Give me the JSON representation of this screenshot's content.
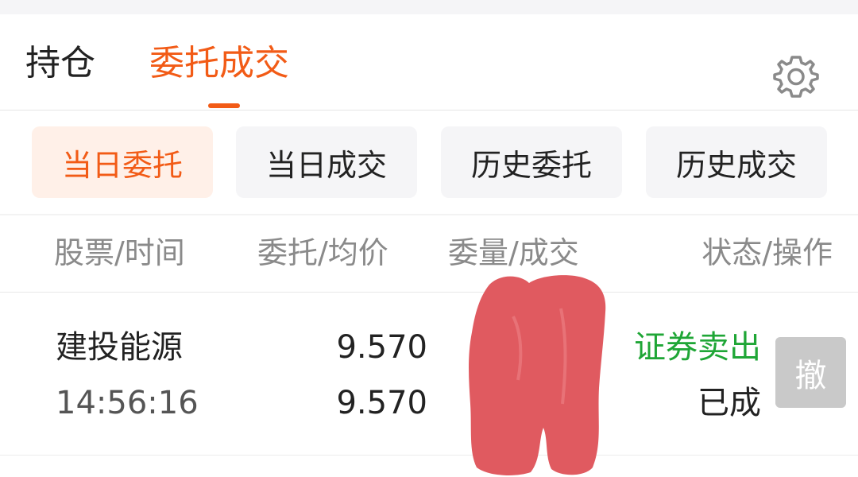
{
  "tabs": {
    "holdings": "持仓",
    "orders": "委托成交"
  },
  "filters": {
    "today_orders": "当日委托",
    "today_trades": "当日成交",
    "history_orders": "历史委托",
    "history_trades": "历史成交"
  },
  "table": {
    "headers": {
      "stock_time": "股票/时间",
      "order_avg": "委托/均价",
      "qty_filled": "委量/成交",
      "status_action": "状态/操作"
    },
    "rows": [
      {
        "stock": "建投能源",
        "time": "14:56:16",
        "order_price": "9.570",
        "avg_price": "9.570",
        "order_type": "证券卖出",
        "status": "已成",
        "action": "撤"
      }
    ]
  },
  "icons": {
    "settings": "gear-icon"
  },
  "colors": {
    "accent": "#f25b16",
    "sell_green": "#1fa636",
    "redaction": "#e05a60"
  }
}
